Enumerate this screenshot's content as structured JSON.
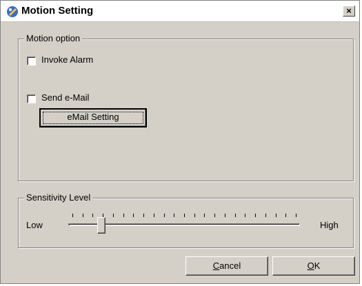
{
  "window": {
    "title": "Motion Setting",
    "close_symbol": "×"
  },
  "icons": {
    "app": "dialog-app-icon",
    "close": "close-icon"
  },
  "motion_option": {
    "legend": "Motion option",
    "invoke_alarm": {
      "label": "Invoke Alarm",
      "checked": false
    },
    "send_email": {
      "label": "Send e-Mail",
      "checked": false
    },
    "email_setting_label": "eMail Setting"
  },
  "sensitivity": {
    "legend": "Sensitivity Level",
    "low_label": "Low",
    "high_label": "High",
    "tick_count": 23,
    "value_fraction": 0.13
  },
  "buttons": {
    "cancel": {
      "mnemonic": "C",
      "rest": "ancel"
    },
    "ok": {
      "mnemonic": "O",
      "rest": "K"
    }
  }
}
